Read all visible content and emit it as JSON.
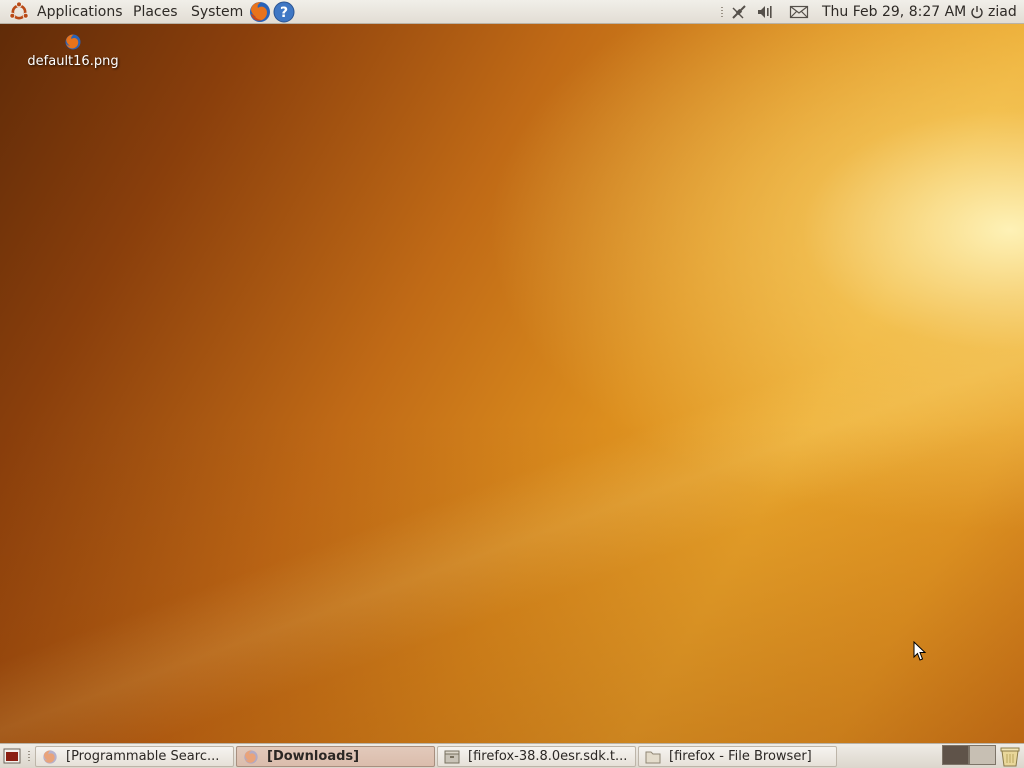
{
  "top_panel": {
    "menus": {
      "applications": "Applications",
      "places": "Places",
      "system": "System"
    },
    "launchers": [
      "firefox-icon",
      "help-icon"
    ],
    "tray_icons": [
      "handle-icon",
      "network-disconnected-icon",
      "volume-muted-icon",
      "mail-icon"
    ],
    "clock": "Thu Feb 29,  8:27 AM",
    "user": "ziad"
  },
  "desktop": {
    "files": [
      {
        "name": "default16.png",
        "icon": "firefox-icon"
      }
    ]
  },
  "taskbar": {
    "tasks": [
      {
        "label": "[Programmable Searc...",
        "icon": "firefox-icon",
        "active": false
      },
      {
        "label": "[Downloads]",
        "icon": "firefox-icon",
        "active": true
      },
      {
        "label": "[firefox-38.8.0esr.sdk.t...",
        "icon": "archive-icon",
        "active": false
      },
      {
        "label": "[firefox - File Browser]",
        "icon": "folder-icon",
        "active": false
      }
    ],
    "workspaces": 2,
    "active_workspace": 1
  },
  "colors": {
    "panel_bg": "#e9e5de",
    "active_task_bg": "#dfc3b3",
    "wallpaper_highlight": "#f7e08a",
    "wallpaper_dark": "#6a2f0a"
  }
}
